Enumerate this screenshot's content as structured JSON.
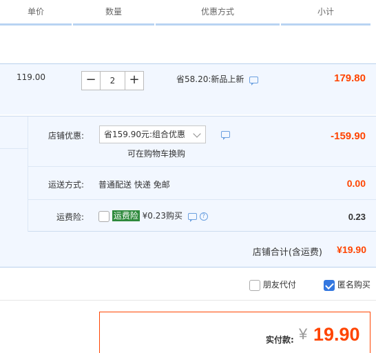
{
  "header": {
    "unit_price": "单价",
    "quantity": "数量",
    "discount": "优惠方式",
    "subtotal": "小计"
  },
  "item": {
    "price": "119.00",
    "minus": "−",
    "quantity": "2",
    "plus": "+",
    "promo": "省58.20:新品上新",
    "subtotal": "179.80"
  },
  "shop": {
    "discount_label": "店铺优惠:",
    "discount_selected": "省159.90元:组合优惠",
    "discount_tip": "可在购物车换购",
    "discount_value": "-159.90",
    "shipping_label": "运送方式:",
    "shipping_value": "普通配送 快递 免邮",
    "shipping_cost": "0.00",
    "insurance_label": "运费险:",
    "insurance_tag": "运费险",
    "insurance_price": "¥0.23购买",
    "insurance_cost": "0.23",
    "total_label": "店铺合计(含运费)",
    "total_value": "¥19.90"
  },
  "options": {
    "friend_pay": "朋友代付",
    "anonymous": "匿名购买"
  },
  "payment": {
    "label": "实付款:",
    "currency": "¥",
    "amount": "19.90"
  },
  "colors": {
    "accent": "#ff4400",
    "header_line": "#b8d3f2",
    "row_bg": "#f2f7ff",
    "checkbox_on": "#3377e0",
    "tag_bg": "#2f8a3d"
  }
}
